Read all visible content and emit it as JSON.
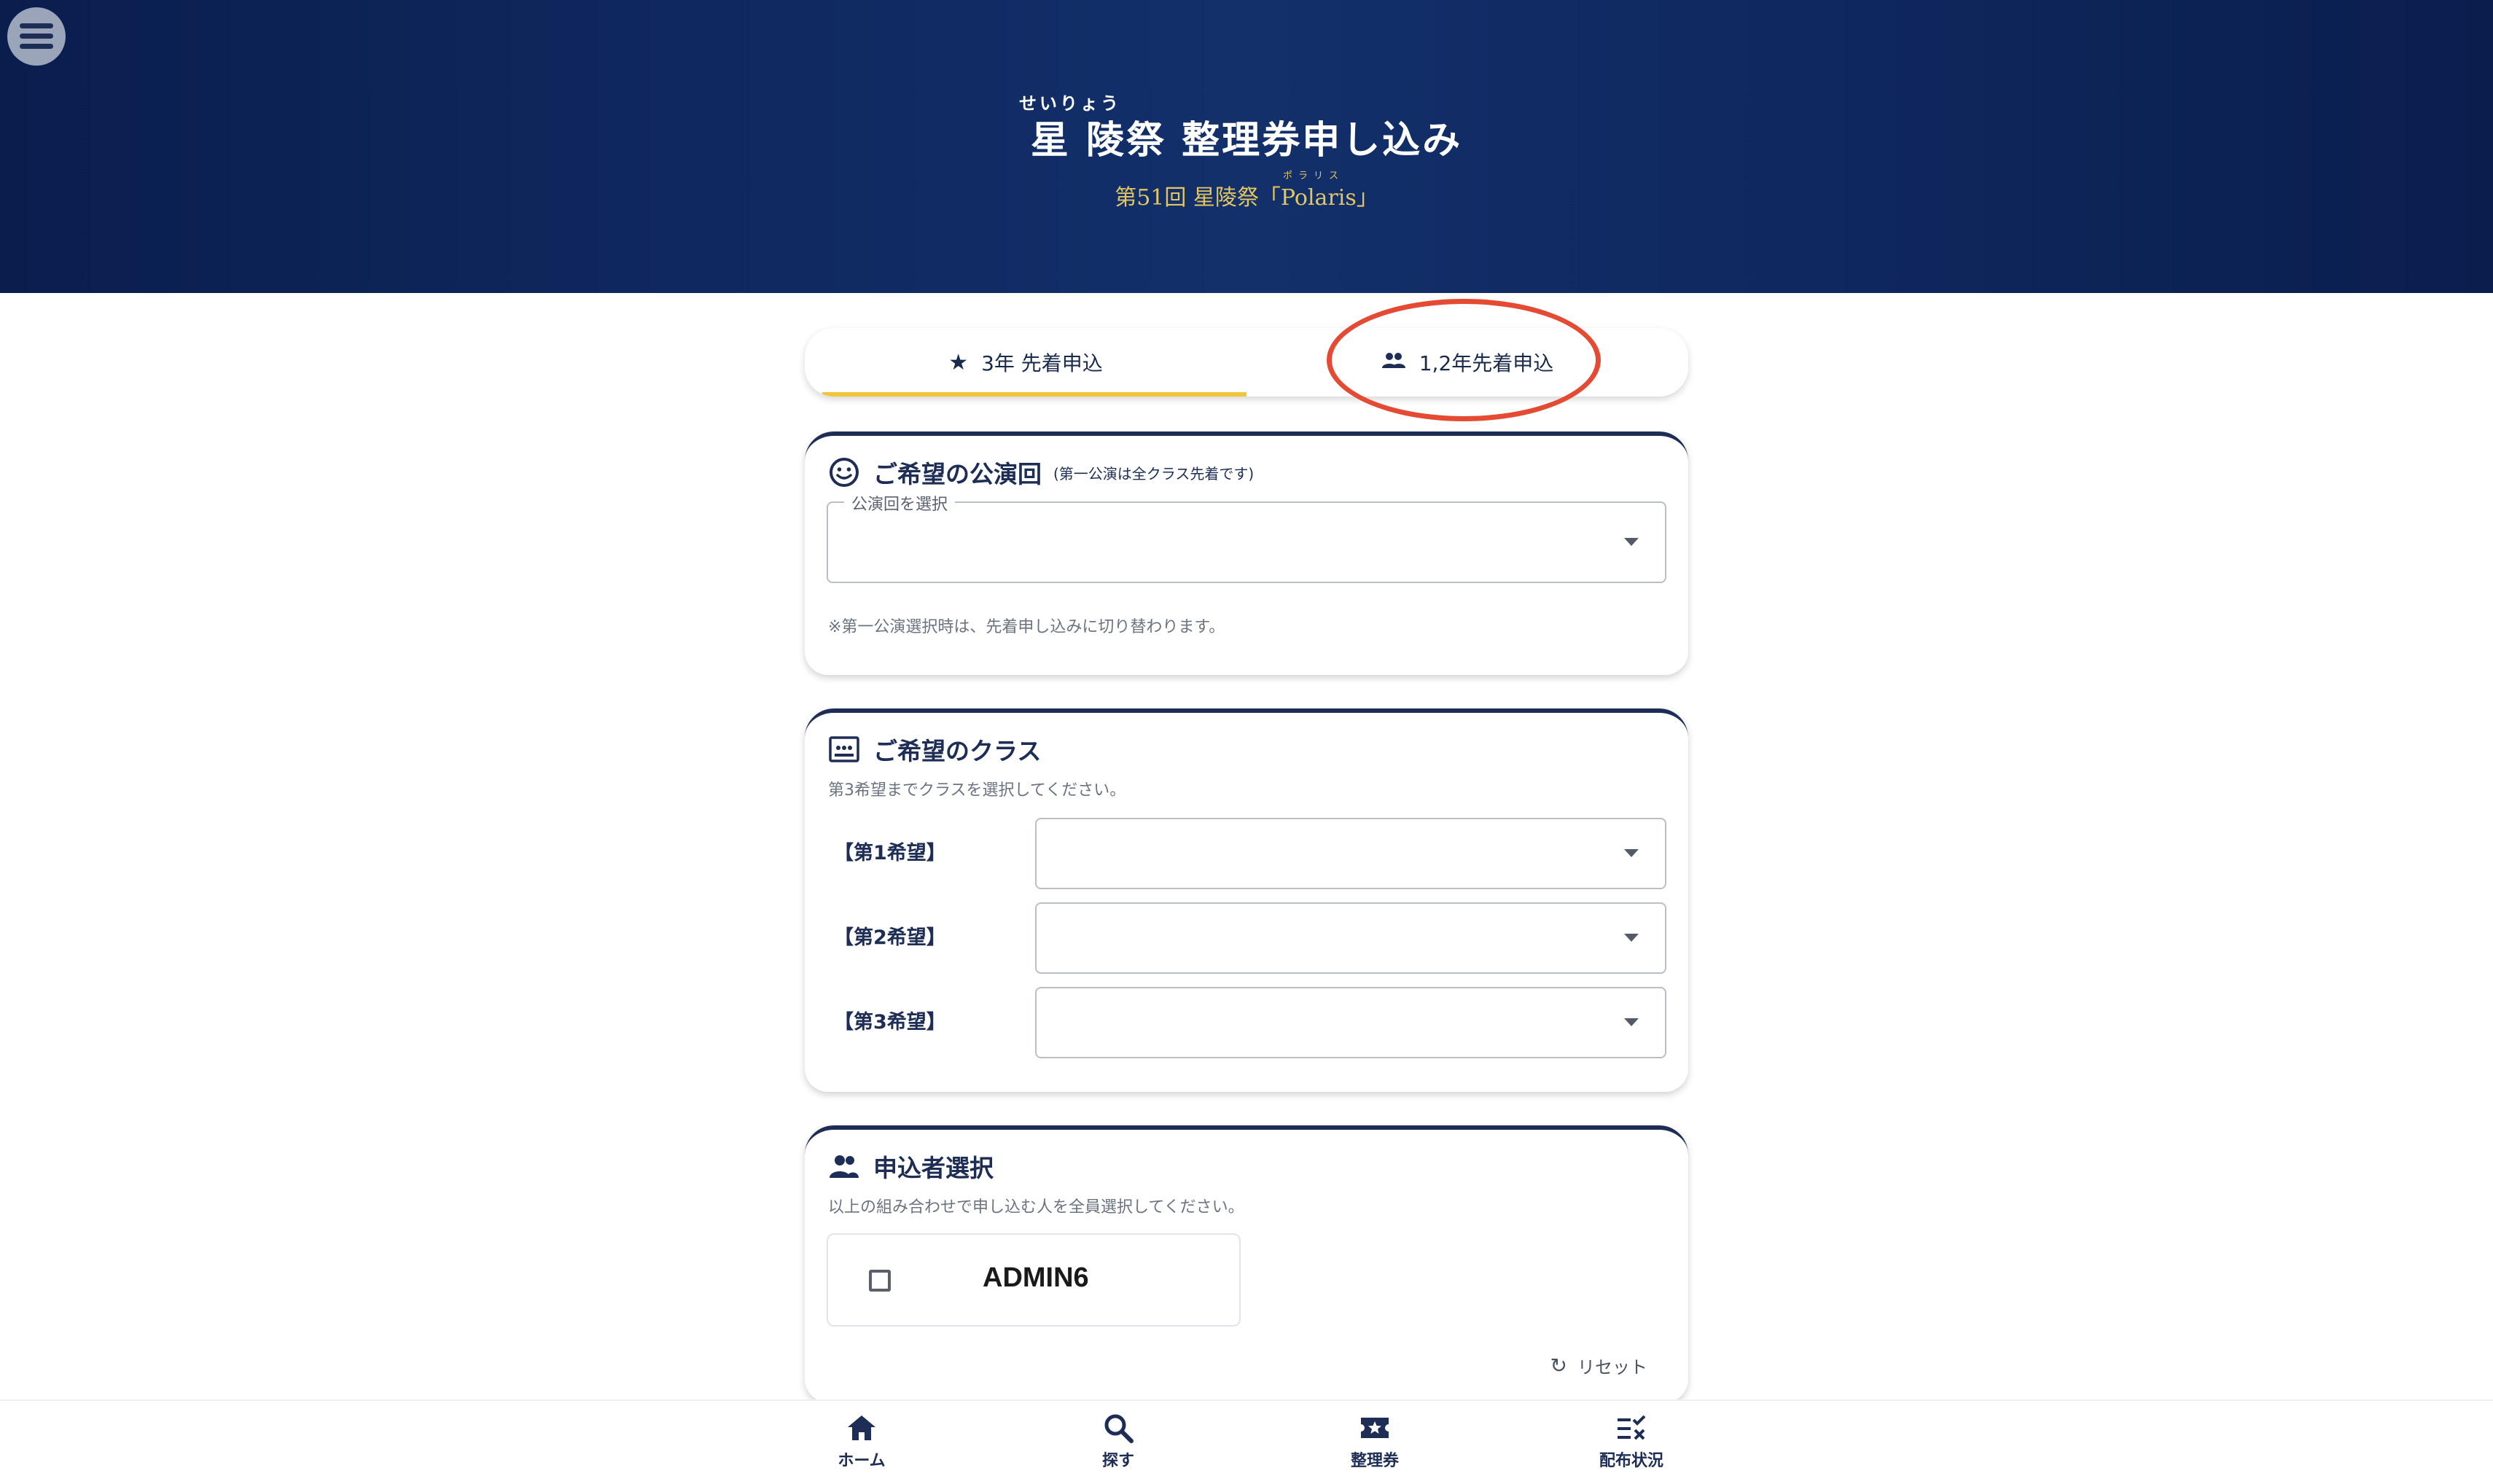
{
  "header": {
    "title_ruby": "せいりょう",
    "title": "星 陵祭 整理券申し込み",
    "subtitle_ruby": "ポラリス",
    "subtitle": "第51回 星陵祭「Polaris」"
  },
  "tabs": [
    {
      "label": "3年 先着申込",
      "icon": "star-icon",
      "active": true
    },
    {
      "label": "1,2年先着申込",
      "icon": "group-icon",
      "active": false
    }
  ],
  "performance": {
    "title": "ご希望の公演回",
    "note": "(第一公演は全クラス先着です)",
    "select_legend": "公演回を選択",
    "select_value": "",
    "hint": "※第一公演選択時は、先着申し込みに切り替わります。"
  },
  "class_choice": {
    "title": "ご希望のクラス",
    "desc": "第3希望までクラスを選択してください。",
    "prefs": [
      {
        "label": "【第1希望】",
        "value": ""
      },
      {
        "label": "【第2希望】",
        "value": ""
      },
      {
        "label": "【第3希望】",
        "value": ""
      }
    ]
  },
  "applicant": {
    "title": "申込者選択",
    "desc": "以上の組み合わせで申し込む人を全員選択してください。",
    "members": [
      {
        "name": "ADMIN6",
        "checked": false
      }
    ],
    "reset_label": "リセット"
  },
  "bottom_nav": [
    {
      "label": "ホーム",
      "icon": "home-icon"
    },
    {
      "label": "探す",
      "icon": "search-icon"
    },
    {
      "label": "整理券",
      "icon": "ticket-icon"
    },
    {
      "label": "配布状況",
      "icon": "checklist-icon"
    }
  ],
  "colors": {
    "header_bg": "#0f2a5f",
    "accent_gold": "#e3c660",
    "tab_active_underline": "#f2c53d",
    "navy": "#1d2d55",
    "annotation_red": "#e54a33"
  }
}
